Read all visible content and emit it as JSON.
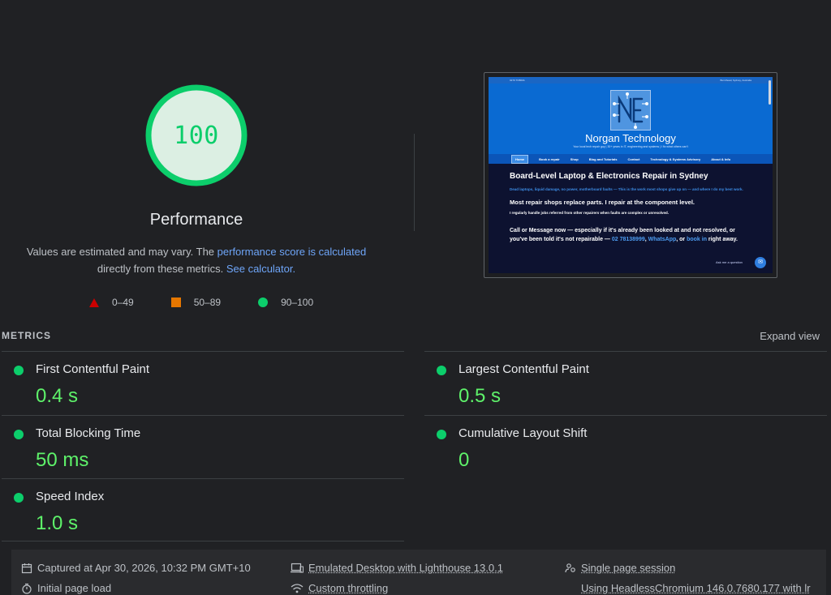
{
  "score": {
    "value": "100",
    "fraction": 1.0,
    "title": "Performance",
    "color": "#0cce6b"
  },
  "description": {
    "text_1": "Values are estimated and may vary. The ",
    "link_1": "performance score is calculated",
    "text_2": " directly from these metrics. ",
    "link_2": "See calculator."
  },
  "legend": {
    "fail": "0–49",
    "average": "50–89",
    "pass": "90–100"
  },
  "thumbnail": {
    "topbar_left": "0279 TOBRIA",
    "topbar_right": "Burnthead, Sydney, Australia",
    "site_name": "Norgan Technology",
    "tagline": "Your local tech repair guy  |  30+ years in IT, engineering and systems  |  I fix what others can't",
    "nav": [
      "Home",
      "Book a repair",
      "Shop",
      "Blog and Tutorials",
      "Contact",
      "Technology & Systems Advisory",
      "About & Info"
    ],
    "heading": "Board-Level Laptop & Electronics Repair in Sydney",
    "blue_text": "Dead laptops, liquid damage, no power, motherboard faults — This is the work most shops give up on — and where I do my best work.",
    "subheading": "Most repair shops replace parts. I repair at the component level.",
    "small_text": "I regularly handle jobs referred from other repairers when faults are complex or unresolved.",
    "cta_1": "Call or Message now — especially if it's already been looked at and not resolved, or you've been told it's not repairable — ",
    "cta_phone": "02 78138999",
    "cta_2": ", ",
    "cta_whatsapp": "WhatsApp",
    "cta_3": ", or ",
    "cta_book": "book in",
    "cta_4": " right away.",
    "ask": "Ask me a question"
  },
  "metrics": {
    "section_label": "METRICS",
    "expand_label": "Expand view",
    "fcp": {
      "name": "First Contentful Paint",
      "value": "0.4 s"
    },
    "lcp": {
      "name": "Largest Contentful Paint",
      "value": "0.5 s"
    },
    "tbt": {
      "name": "Total Blocking Time",
      "value": "50 ms"
    },
    "cls": {
      "name": "Cumulative Layout Shift",
      "value": "0"
    },
    "si": {
      "name": "Speed Index",
      "value": "1.0 s"
    }
  },
  "footer": {
    "captured": "Captured at Apr 30, 2026, 10:32 PM GMT+10",
    "emulated": "Emulated Desktop with Lighthouse 13.0.1",
    "session": "Single page session",
    "load": "Initial page load",
    "throttling": "Custom throttling",
    "browser": "Using HeadlessChromium 146.0.7680.177 with lr"
  },
  "colors": {
    "background": "#202124",
    "pass": "#0cce6b",
    "average": "#e67700",
    "fail": "#cc0000",
    "link": "#6ea5f8",
    "metric_value": "#5ef26a"
  },
  "icons": {
    "calendar": "calendar-icon",
    "desktop": "desktop-icon",
    "session": "people-icon",
    "timer": "stopwatch-icon",
    "wifi": "wifi-icon"
  }
}
